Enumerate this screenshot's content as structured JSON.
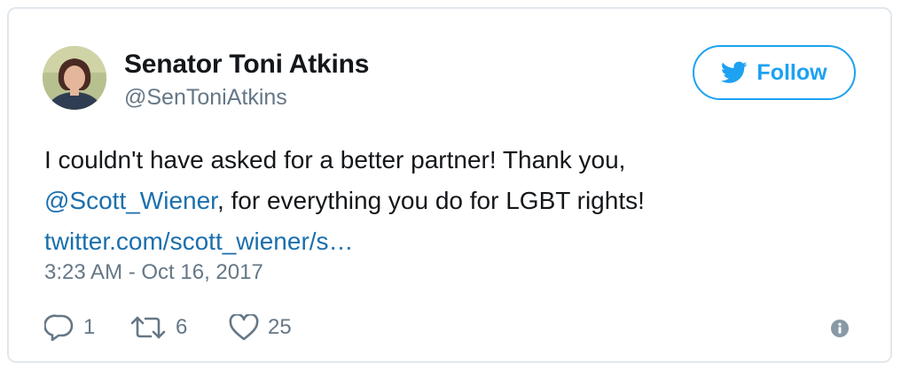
{
  "author": {
    "name": "Senator Toni Atkins",
    "handle": "@SenToniAtkins"
  },
  "follow_button": {
    "label": "Follow",
    "icon": "twitter-bird-icon"
  },
  "tweet": {
    "line1": "I couldn't have asked for a better partner! Thank you,",
    "mention": "@Scott_Wiener",
    "line2_rest": ", for everything you do for LGBT rights!",
    "link": "twitter.com/scott_wiener/s…"
  },
  "timestamp": "3:23 AM - Oct 16, 2017",
  "actions": {
    "reply_count": "1",
    "retweet_count": "6",
    "like_count": "25"
  },
  "colors": {
    "brand": "#1da1f2",
    "link": "#1b6fad",
    "muted": "#657786",
    "border": "#e1e8ed"
  }
}
